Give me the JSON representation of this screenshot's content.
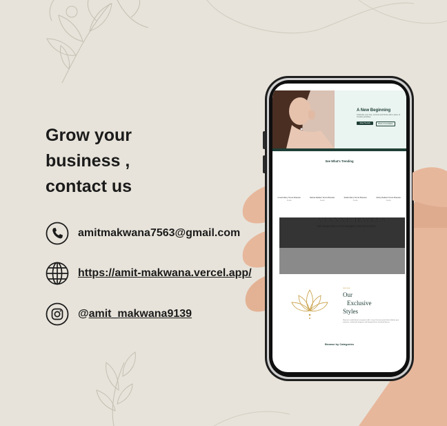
{
  "headline": {
    "line1": "Grow your",
    "line2": "business ,",
    "line3": "contact us"
  },
  "contacts": {
    "email": "amitmakwana7563@gmail.com",
    "website": "https://amit-makwana.vercel.app/",
    "instagram_at": "@",
    "instagram_handle": "amit_makwana9139"
  },
  "icons": {
    "phone": "phone-icon",
    "globe": "globe-icon",
    "instagram": "instagram-icon",
    "lotus": "lotus-icon"
  },
  "site": {
    "hero_title": "A New Beginning",
    "hero_sub": "Celebrate your love, success and future with a piece of timeless jewellery.",
    "hero_btn1": "Shop The Edit",
    "hero_btn2": "Book a Consultation",
    "trending_title": "See What's Trending",
    "products": [
      {
        "name": "Crowd Marry Tennis Bracelet",
        "price": "₹5,999"
      },
      {
        "name": "Nebula Radiant Tennis Bracelet",
        "price": "₹6,499"
      },
      {
        "name": "Stellar Marry Tennis Bracelet",
        "price": "₹5,499"
      },
      {
        "name": "Infinity Radiant Tennis Bracelet",
        "price": "₹6,999"
      }
    ],
    "banner_brand": "VIANNE JEWELS",
    "banner_tagline": "THE SIGNATURE OF AFFORDABLE SOPHISTICATION",
    "excl_small": "NEW ERA",
    "excl_l1": "Our",
    "excl_l2": "Exclusive",
    "excl_l3": "Styles",
    "excl_para": "Step into a world where every piece tells a story. Discover jewels that celebrate your moments, crafted with elegance and designed to be cherished forever.",
    "browse_title": "Browse by Categories"
  },
  "colors": {
    "background": "#e7e3da",
    "text": "#1b1b1b",
    "accent_green": "#1e3f36",
    "gold": "#c9a24b"
  }
}
